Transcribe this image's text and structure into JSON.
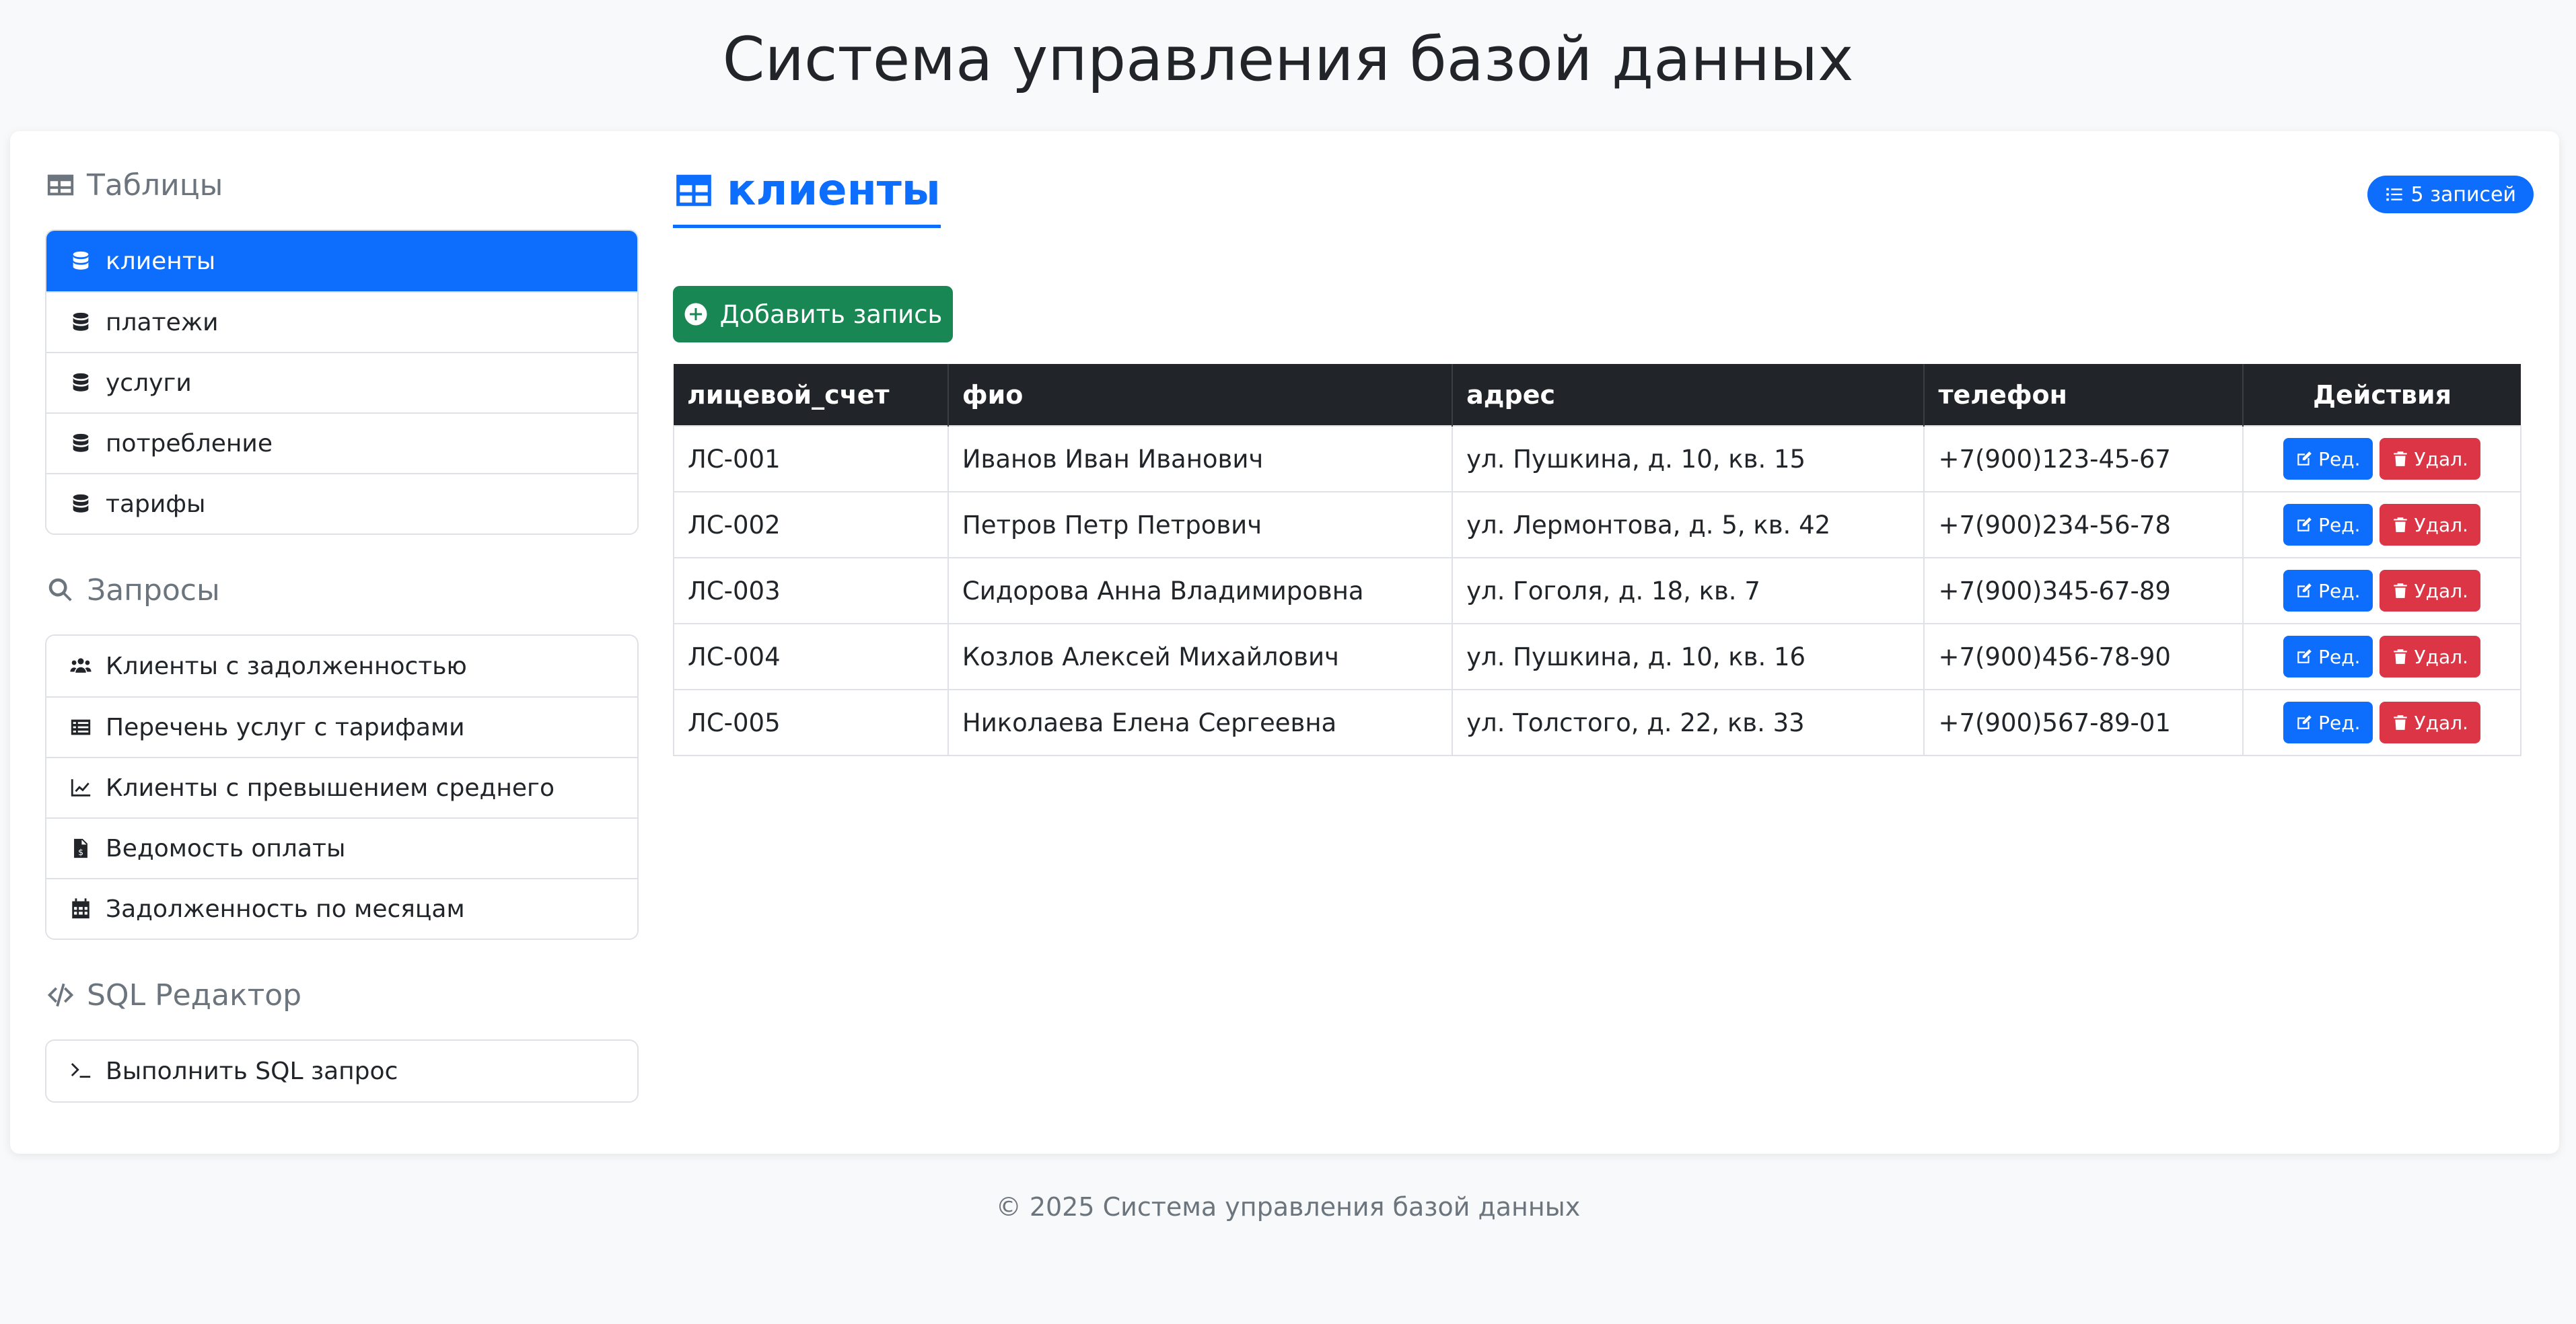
{
  "header": {
    "title": "Система управления базой данных"
  },
  "sidebar": {
    "tables_heading": "Таблицы",
    "tables": [
      {
        "label": "клиенты",
        "active": true
      },
      {
        "label": "платежи"
      },
      {
        "label": "услуги"
      },
      {
        "label": "потребление"
      },
      {
        "label": "тарифы"
      }
    ],
    "queries_heading": "Запросы",
    "queries": [
      {
        "label": "Клиенты с задолженностью",
        "icon": "users-icon"
      },
      {
        "label": "Перечень услуг с тарифами",
        "icon": "list-icon"
      },
      {
        "label": "Клиенты с превышением среднего",
        "icon": "chart-line-icon"
      },
      {
        "label": "Ведомость оплаты",
        "icon": "file-invoice-icon"
      },
      {
        "label": "Задолженность по месяцам",
        "icon": "calendar-icon"
      }
    ],
    "sql_heading": "SQL Редактор",
    "sql_items": [
      {
        "label": "Выполнить SQL запрос",
        "icon": "terminal-icon"
      }
    ]
  },
  "main": {
    "table_title": "клиенты",
    "records_badge": "5 записей",
    "add_button": "Добавить запись",
    "columns": [
      "лицевой_счет",
      "фио",
      "адрес",
      "телефон",
      "Действия"
    ],
    "rows": [
      [
        "ЛС-001",
        "Иванов Иван Иванович",
        "ул. Пушкина, д. 10, кв. 15",
        "+7(900)123-45-67"
      ],
      [
        "ЛС-002",
        "Петров Петр Петрович",
        "ул. Лермонтова, д. 5, кв. 42",
        "+7(900)234-56-78"
      ],
      [
        "ЛС-003",
        "Сидорова Анна Владимировна",
        "ул. Гоголя, д. 18, кв. 7",
        "+7(900)345-67-89"
      ],
      [
        "ЛС-004",
        "Козлов Алексей Михайлович",
        "ул. Пушкина, д. 10, кв. 16",
        "+7(900)456-78-90"
      ],
      [
        "ЛС-005",
        "Николаева Елена Сергеевна",
        "ул. Толстого, д. 22, кв. 33",
        "+7(900)567-89-01"
      ]
    ],
    "edit_label": "Ред.",
    "delete_label": "Удал."
  },
  "footer": {
    "text": "© 2025 Система управления базой данных"
  },
  "colors": {
    "primary": "#0d6efd",
    "success": "#198754",
    "danger": "#dc3545",
    "table_header": "#212529"
  }
}
